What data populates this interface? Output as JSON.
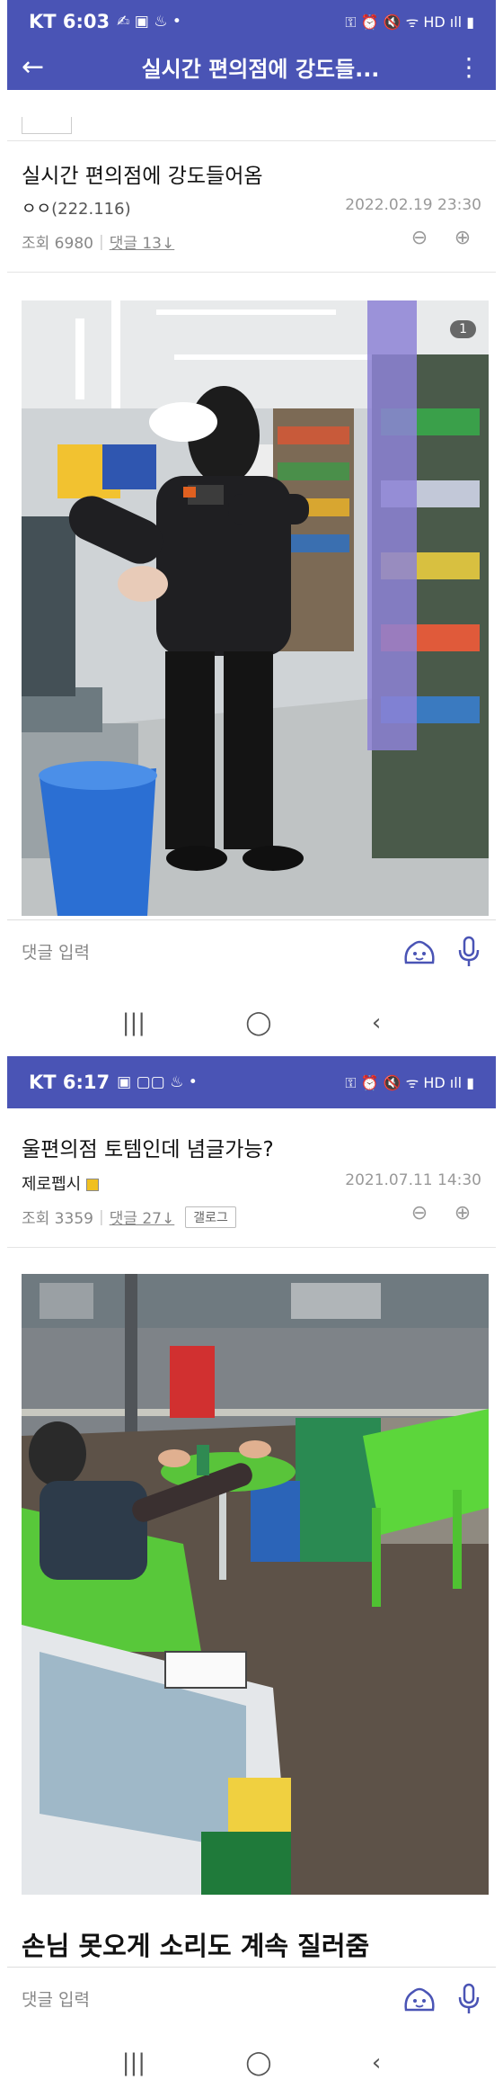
{
  "screen1": {
    "status": {
      "carrier_time": "KT 6:03",
      "left_icons": "✍ ▣ ♨ •",
      "right_icons": "⚿ ⏰ 🔇 ᯤ HD ıll ▮"
    },
    "appbar": {
      "title": "실시간 편의점에 강도들..."
    },
    "post": {
      "title": "실시간 편의점에 강도들어옴",
      "author": "ㅇㅇ",
      "ip": "(222.116)",
      "date": "2022.02.19 23:30",
      "views": "조회 6980",
      "comments": "댓글 13↓"
    },
    "photo_badge": "1",
    "comment_placeholder": "댓글 입력"
  },
  "screen2": {
    "status": {
      "carrier_time": "KT 6:17",
      "left_icons": "▣ ▢▢ ♨ •",
      "right_icons": "⚿ ⏰ 🔇 ᯤ HD ıll ▮"
    },
    "post": {
      "title": "울편의점 토템인데 념글가능?",
      "author": "제로펩시",
      "date": "2021.07.11 14:30",
      "views": "조회 3359",
      "comments": "댓글 27↓",
      "gallog": "갤로그"
    },
    "caption": "손님 못오게 소리도 계속 질러줌",
    "comment_placeholder": "댓글 입력"
  },
  "nav": {
    "recent": "|||",
    "home": "◯",
    "back": "‹"
  },
  "colors": {
    "header": "#4a54b5",
    "muted": "#999999"
  }
}
